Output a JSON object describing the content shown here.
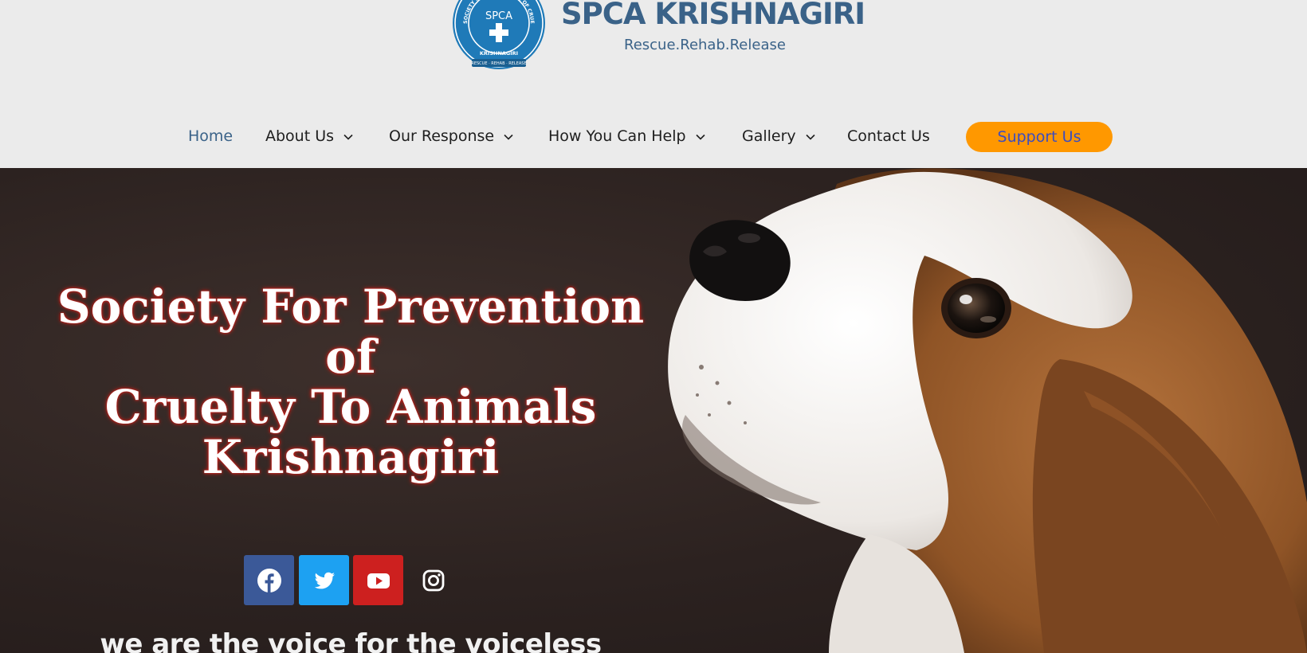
{
  "header": {
    "logo": {
      "center_text": "SPCA",
      "ring_text_top": "SOCIETY FOR PREVENTION OF CRUELTY TO ANIMALS · BE KIND TO ANIMALS",
      "ring_text_bottom": "KRISHNAGIRI",
      "ribbon_text": "RESCUE · REHAB · RELEASE"
    },
    "site_title": "SPCA KRISHNAGIRI",
    "tagline": "Rescue.Rehab.Release"
  },
  "nav": {
    "items": [
      {
        "label": "Home",
        "active": true,
        "has_dropdown": false
      },
      {
        "label": "About Us",
        "active": false,
        "has_dropdown": true
      },
      {
        "label": "Our Response",
        "active": false,
        "has_dropdown": true
      },
      {
        "label": "How You Can Help",
        "active": false,
        "has_dropdown": true
      },
      {
        "label": "Gallery",
        "active": false,
        "has_dropdown": true
      },
      {
        "label": "Contact Us",
        "active": false,
        "has_dropdown": false
      }
    ],
    "cta_label": "Support Us"
  },
  "hero": {
    "title_lines": [
      "Society For Prevention of",
      "Cruelty To Animals",
      "Krishnagiri"
    ],
    "social": [
      "facebook-icon",
      "twitter-icon",
      "youtube-icon",
      "instagram-icon"
    ],
    "motto": "we are the voice for the voiceless"
  },
  "colors": {
    "brand_blue": "#3a6288",
    "cta_orange": "#ff9800",
    "cta_text": "#3b4cc0",
    "facebook": "#3b5998",
    "twitter": "#1da1f2",
    "youtube": "#cd201f"
  }
}
